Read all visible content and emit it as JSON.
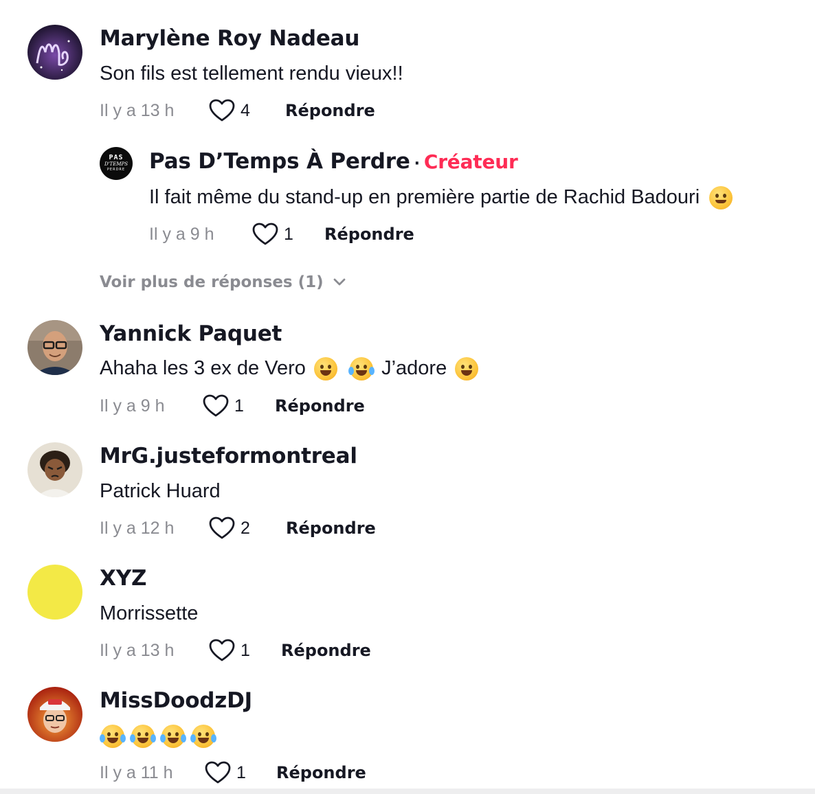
{
  "comments": [
    {
      "username": "Marylène Roy Nadeau",
      "text": "Son fils est tellement rendu vieux!!",
      "time": "Il y a 13 h",
      "likes": "4",
      "reply_label": "Répondre"
    },
    {
      "username": "Yannick Paquet",
      "text_parts": [
        "Ahaha les 3 ex de Vero",
        "J’adore"
      ],
      "time": "Il y a 9 h",
      "likes": "1",
      "reply_label": "Répondre"
    },
    {
      "username": "MrG.justeformontreal",
      "text": "Patrick Huard",
      "time": "Il y a 12 h",
      "likes": "2",
      "reply_label": "Répondre"
    },
    {
      "username": "XYZ",
      "text": "Morrissette",
      "time": "Il y a 13 h",
      "likes": "1",
      "reply_label": "Répondre"
    },
    {
      "username": "MissDoodzDJ",
      "time": "Il y a 11 h",
      "likes": "1",
      "reply_label": "Répondre"
    }
  ],
  "creator_reply": {
    "username": "Pas D’Temps À Perdre",
    "separator": "·",
    "badge": "Créateur",
    "text": "Il fait même du stand-up en première partie de Rachid Badouri",
    "time": "Il y a 9 h",
    "likes": "1",
    "reply_label": "Répondre",
    "avatar_text": [
      "PAS",
      "D'TEMPS",
      "PERDRE"
    ]
  },
  "view_more": "Voir plus de réponses (1)",
  "avatar_colors": {
    "marylene": "#2a1f3d",
    "yannick": "#6b5a4a",
    "mrg": "#d8d2c6",
    "xyz": "#f5e94a",
    "missdoodz": "#c4371e"
  }
}
